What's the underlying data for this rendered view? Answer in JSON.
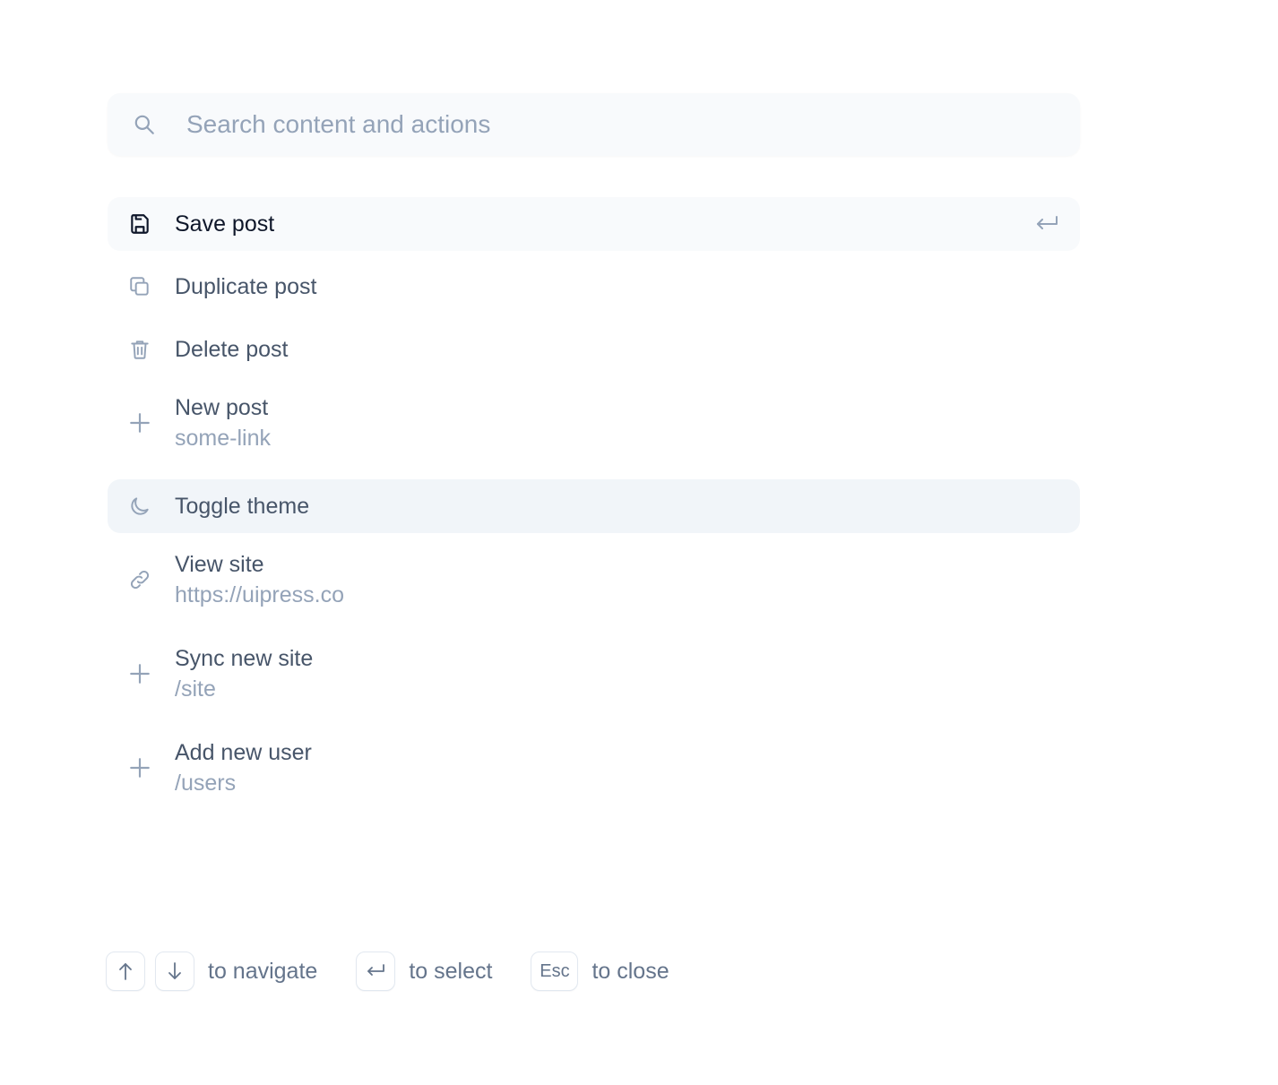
{
  "search": {
    "placeholder": "Search content and actions",
    "icon": "search-icon"
  },
  "items": [
    {
      "label": "Save post",
      "icon": "save-icon",
      "state": "active",
      "shortcut_icon": "enter-icon"
    },
    {
      "label": "Duplicate post",
      "icon": "duplicate-icon"
    },
    {
      "label": "Delete post",
      "icon": "trash-icon"
    },
    {
      "label": "New post",
      "sub": "some-link",
      "icon": "plus-icon"
    },
    {
      "label": "Toggle theme",
      "icon": "moon-icon",
      "state": "hover"
    },
    {
      "label": "View site",
      "sub": "https://uipress.co",
      "icon": "link-icon"
    },
    {
      "label": "Sync new site",
      "sub": "/site",
      "icon": "plus-icon"
    },
    {
      "label": "Add new user",
      "sub": "/users",
      "icon": "plus-icon"
    }
  ],
  "footer": {
    "navigate_text": "to navigate",
    "select_text": "to select",
    "esc_key": "Esc",
    "close_text": "to close"
  },
  "colors": {
    "text": "#475569",
    "text_active": "#0f172a",
    "muted": "#94a3b8",
    "active_bg": "#f8fafc",
    "hover_bg": "#f1f5f9",
    "border": "#e2e8f0"
  }
}
